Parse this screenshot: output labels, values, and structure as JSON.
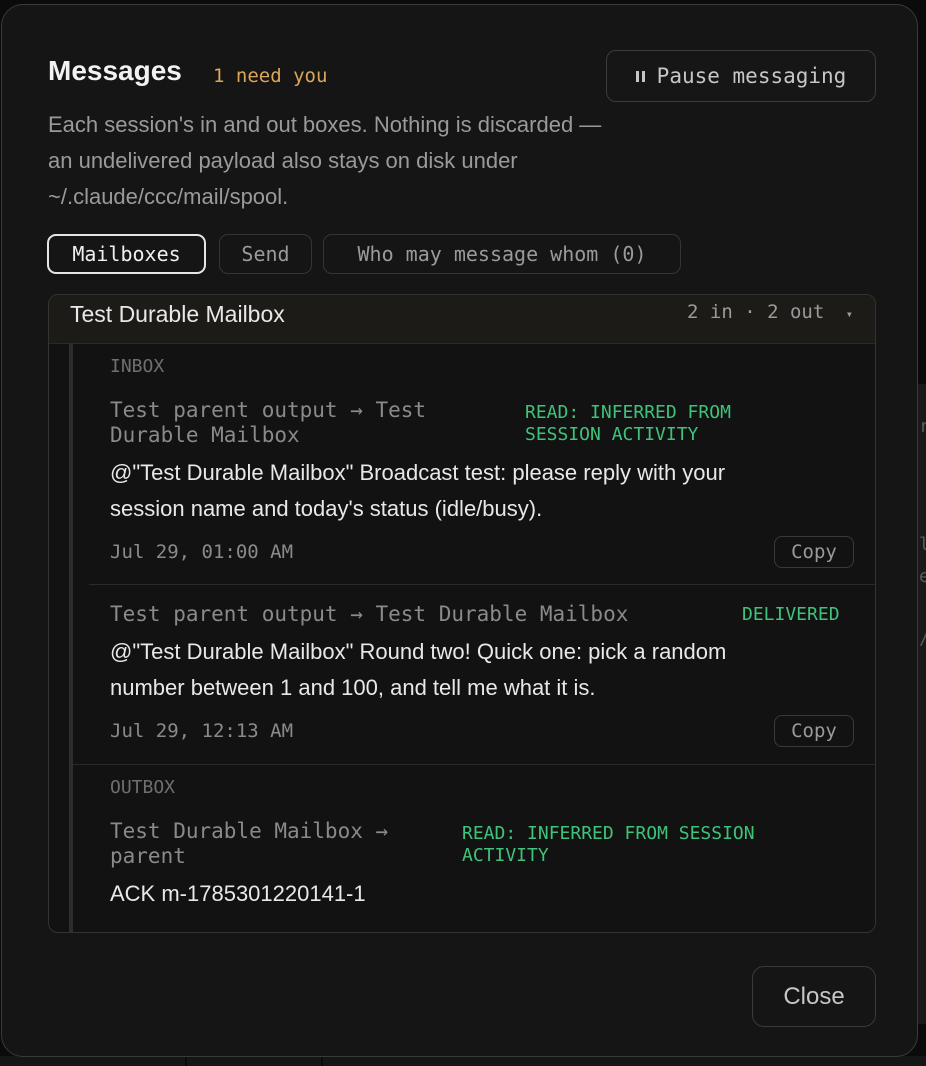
{
  "header": {
    "title": "Messages",
    "need_badge": "1 need you",
    "pause_label": "Pause messaging",
    "description": "Each session's in and out boxes. Nothing is discarded — an undelivered payload also stays on disk under ~/.claude/ccc/mail/spool."
  },
  "tabs": [
    {
      "label": "Mailboxes",
      "active": true
    },
    {
      "label": "Send",
      "active": false
    },
    {
      "label": "Who may message whom (0)",
      "active": false
    }
  ],
  "mailbox": {
    "title": "Test Durable Mailbox",
    "counts": "2 in · 2 out",
    "inbox_label": "INBOX",
    "outbox_label": "OUTBOX",
    "inbox": [
      {
        "from_line1": "Test parent output → Test",
        "from_line2": "Durable Mailbox",
        "status_line1": "READ: INFERRED FROM",
        "status_line2": "SESSION ACTIVITY",
        "body_line1": "@\"Test Durable Mailbox\" Broadcast test: please reply with your",
        "body_line2": "session name and today's status (idle/busy).",
        "timestamp": "Jul 29, 01:00 AM",
        "copy_label": "Copy"
      },
      {
        "from": "Test parent output → Test Durable Mailbox",
        "status": "DELIVERED",
        "body_line1": "@\"Test Durable Mailbox\" Round two! Quick one: pick a random",
        "body_line2": "number between 1 and 100, and tell me what it is.",
        "timestamp": "Jul 29, 12:13 AM",
        "copy_label": "Copy"
      }
    ],
    "outbox": [
      {
        "from_line1": "Test Durable Mailbox →",
        "from_line2": "parent",
        "status_line1": "READ: INFERRED FROM SESSION",
        "status_line2": "ACTIVITY",
        "body": "ACK m-1785301220141-1"
      }
    ]
  },
  "footer": {
    "close_label": "Close"
  },
  "background": {
    "glyphs": [
      "r",
      "l",
      "e",
      "/"
    ]
  },
  "colors": {
    "accent_badge": "#d9a65b",
    "status_green": "#3fc37b",
    "modal_bg": "#151515"
  }
}
